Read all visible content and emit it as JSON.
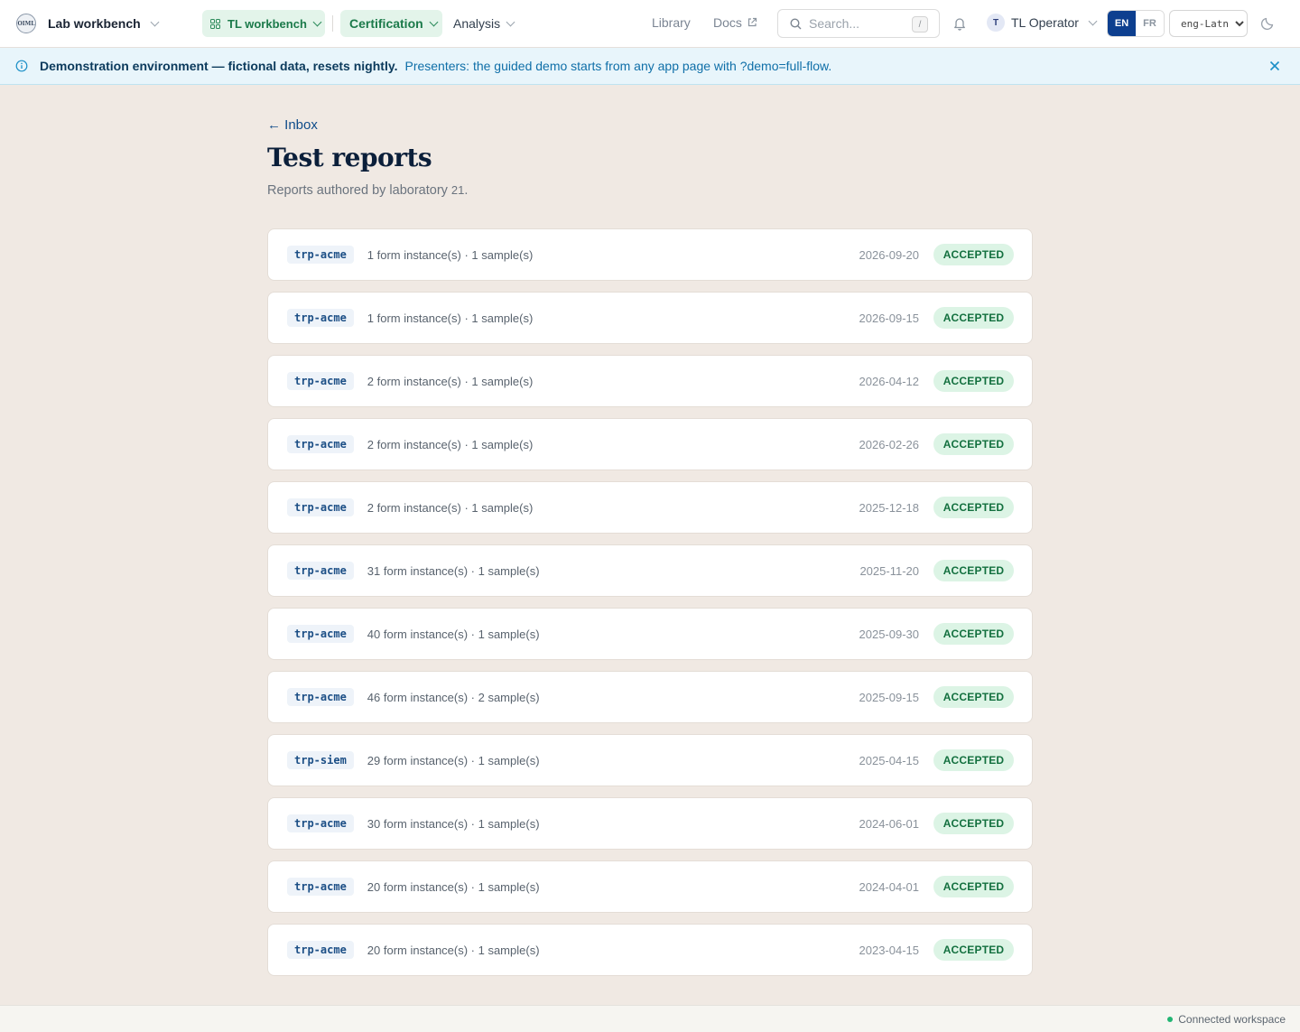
{
  "header": {
    "brand_logo_text": "OIML",
    "brand_name": "Lab workbench",
    "workspace_label": "TL workbench",
    "nav": {
      "certification": "Certification",
      "analysis": "Analysis",
      "library": "Library",
      "docs": "Docs"
    },
    "search_placeholder": "Search...",
    "search_shortcut": "/",
    "user_initial": "T",
    "user_name": "TL Operator",
    "lang_en": "EN",
    "lang_fr": "FR",
    "script_selected": "eng-Latn"
  },
  "banner": {
    "strong": "Demonstration environment — fictional data, resets nightly.",
    "text": "Presenters: the guided demo starts from any app page with ?demo=full-flow."
  },
  "page": {
    "back_label": "← Inbox",
    "title": "Test reports",
    "subtitle_prefix": "Reports authored by laboratory ",
    "lab_id": "21",
    "subtitle_suffix": "."
  },
  "reports": [
    {
      "tag": "trp-acme",
      "summary": "1 form instance(s) · 1 sample(s)",
      "date": "2026-09-20",
      "status": "ACCEPTED"
    },
    {
      "tag": "trp-acme",
      "summary": "1 form instance(s) · 1 sample(s)",
      "date": "2026-09-15",
      "status": "ACCEPTED"
    },
    {
      "tag": "trp-acme",
      "summary": "2 form instance(s) · 1 sample(s)",
      "date": "2026-04-12",
      "status": "ACCEPTED"
    },
    {
      "tag": "trp-acme",
      "summary": "2 form instance(s) · 1 sample(s)",
      "date": "2026-02-26",
      "status": "ACCEPTED"
    },
    {
      "tag": "trp-acme",
      "summary": "2 form instance(s) · 1 sample(s)",
      "date": "2025-12-18",
      "status": "ACCEPTED"
    },
    {
      "tag": "trp-acme",
      "summary": "31 form instance(s) · 1 sample(s)",
      "date": "2025-11-20",
      "status": "ACCEPTED"
    },
    {
      "tag": "trp-acme",
      "summary": "40 form instance(s) · 1 sample(s)",
      "date": "2025-09-30",
      "status": "ACCEPTED"
    },
    {
      "tag": "trp-acme",
      "summary": "46 form instance(s) · 2 sample(s)",
      "date": "2025-09-15",
      "status": "ACCEPTED"
    },
    {
      "tag": "trp-siem",
      "summary": "29 form instance(s) · 1 sample(s)",
      "date": "2025-04-15",
      "status": "ACCEPTED"
    },
    {
      "tag": "trp-acme",
      "summary": "30 form instance(s) · 1 sample(s)",
      "date": "2024-06-01",
      "status": "ACCEPTED"
    },
    {
      "tag": "trp-acme",
      "summary": "20 form instance(s) · 1 sample(s)",
      "date": "2024-04-01",
      "status": "ACCEPTED"
    },
    {
      "tag": "trp-acme",
      "summary": "20 form instance(s) · 1 sample(s)",
      "date": "2023-04-15",
      "status": "ACCEPTED"
    }
  ],
  "footer": {
    "connection": "Connected workspace"
  },
  "colors": {
    "accent_green": "#1b7a4a",
    "accept_bg": "#dcf4e5",
    "lang_active": "#0d3f8f",
    "page_bg": "#f0e9e3"
  },
  "icons": [
    "workspace-grid-icon",
    "chevron-down-icon",
    "external-link-icon",
    "search-icon",
    "bell-icon",
    "moon-icon",
    "info-icon",
    "close-icon",
    "connection-dot-icon"
  ]
}
